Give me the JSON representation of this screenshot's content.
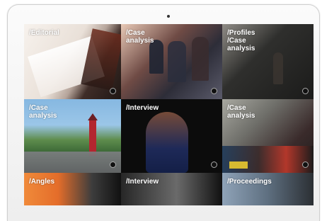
{
  "tiles": [
    {
      "label": "/Editorial"
    },
    {
      "label": "/Case\nanalysis"
    },
    {
      "label": "/Profiles\n/Case\nanalysis"
    },
    {
      "label": "/Case\nanalysis"
    },
    {
      "label": "/Interview"
    },
    {
      "label": "/Case\nanalysis"
    },
    {
      "label": "/Angles"
    },
    {
      "label": "/Interview"
    },
    {
      "label": "/Proceedings"
    }
  ],
  "colors": {
    "frame": "#f3f3f3",
    "screen": "#111111"
  }
}
